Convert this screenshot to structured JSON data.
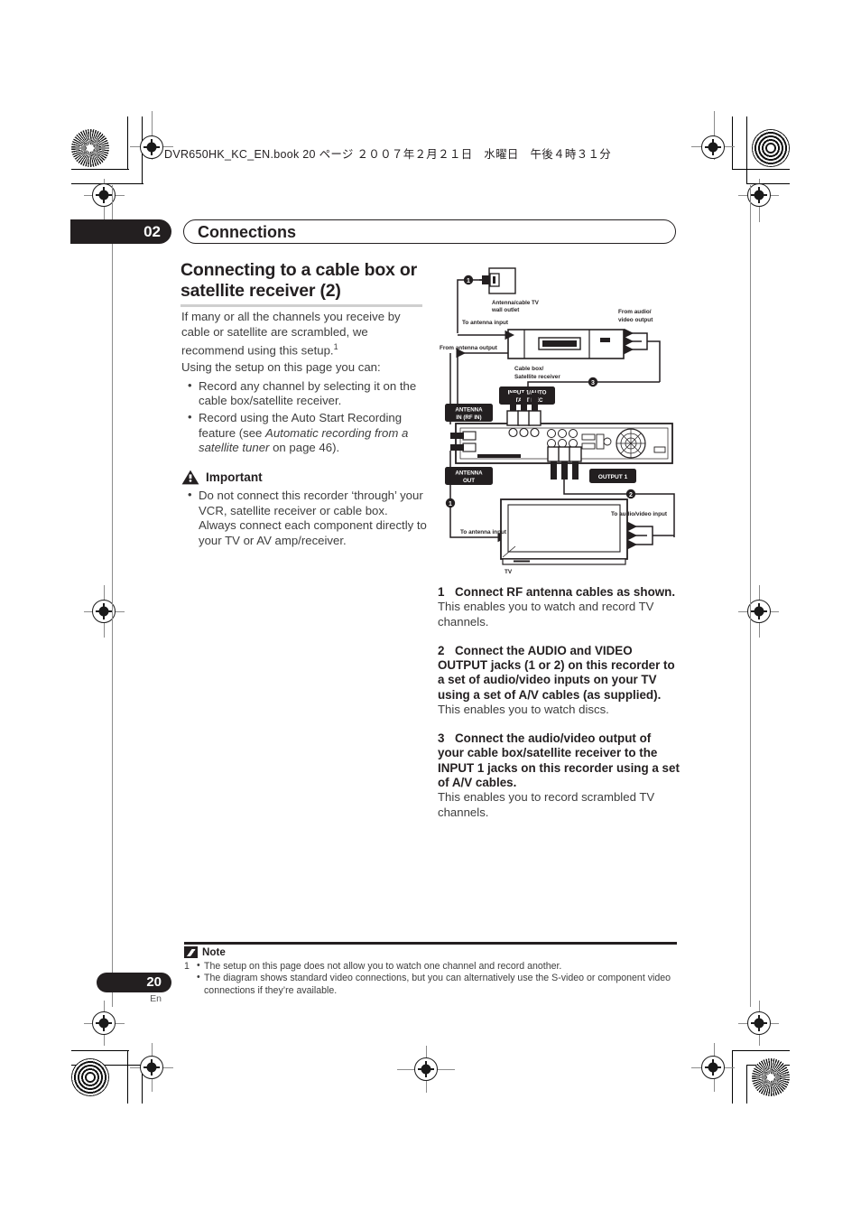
{
  "header": {
    "file_line": "DVR650HK_KC_EN.book  20 ページ  ２００７年２月２１日　水曜日　午後４時３１分"
  },
  "chapter": {
    "number": "02",
    "title": "Connections"
  },
  "section": {
    "heading": "Connecting to a cable box or satellite receiver (2)",
    "intro_1": "If many or all the channels you receive by cable or satellite are scrambled, we recommend using this setup.",
    "intro_1_footnote": "1",
    "intro_2": "Using the setup on this page you can:",
    "bullets": [
      "Record any channel by selecting it on the cable box/satellite receiver.",
      {
        "pre": "Record using the Auto Start Recording feature (see ",
        "italic": "Automatic recording from a satellite tuner",
        "post": " on page 46)."
      }
    ]
  },
  "important": {
    "icon": "warning-triangle-icon",
    "label": "Important",
    "bullet": "Do not connect this recorder ‘through’ your VCR, satellite receiver or cable box. Always connect each component directly to your TV or AV amp/receiver."
  },
  "steps": [
    {
      "number": "1",
      "title": "Connect RF antenna cables as shown.",
      "description": "This enables you to watch and record TV channels."
    },
    {
      "number": "2",
      "title": "Connect the AUDIO and VIDEO OUTPUT jacks (1 or 2) on this recorder to a set of audio/video inputs on your TV using a set of A/V cables (as supplied).",
      "description": "This enables you to watch discs."
    },
    {
      "number": "3",
      "title": "Connect the audio/video output of your cable box/satellite receiver to the INPUT 1 jacks on this recorder using a set of A/V cables.",
      "description": "This enables you to record scrambled TV channels."
    }
  ],
  "diagram": {
    "labels": {
      "wall_outlet": "Antenna/cable TV",
      "wall_outlet_2": "wall outlet",
      "to_antenna_input_top": "To antenna input",
      "from_antenna_output": "From antenna output",
      "cable_box_1": "Cable box/",
      "cable_box_2": "Satellite receiver",
      "from_av_output_1": "From audio/",
      "from_av_output_2": "video output",
      "antenna_in_1": "ANTENNA",
      "antenna_in_2": "IN (RF IN)",
      "antenna_out_1": "ANTENNA",
      "antenna_out_2": "OUT",
      "input1_1": "INPUT 1/AUTO",
      "input1_2": "START REC",
      "output1": "OUTPUT 1",
      "to_antenna_input_tv": "To antenna input",
      "to_av_input": "To audio/video input",
      "tv": "TV"
    },
    "markers": [
      "1",
      "2",
      "3"
    ]
  },
  "note": {
    "icon": "pencil-icon",
    "label": "Note",
    "footnote_index": "1",
    "lines": [
      "The setup on this page does not allow you to watch one channel and record another.",
      "The diagram shows standard video connections, but you can alternatively use the S-video or component video connections if they’re available."
    ]
  },
  "footer": {
    "page_number": "20",
    "language": "En"
  },
  "colors": {
    "ink": "#231f20",
    "body_text": "#3d3d3d",
    "rule_gray": "#cfcfcf",
    "mark_gray": "#8c8c8c"
  }
}
